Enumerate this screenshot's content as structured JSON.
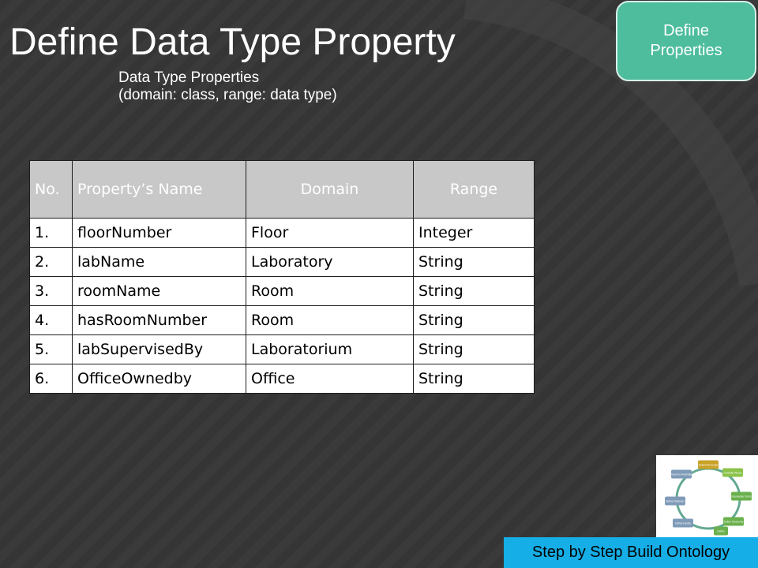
{
  "title": "Define Data Type Property",
  "subtitle": {
    "line1": "Data Type Properties",
    "line2": "(domain: class, range: data type)"
  },
  "badge": {
    "line1": "Define",
    "line2": "Properties"
  },
  "table": {
    "headers": [
      "No.",
      "Property’s Name",
      "Domain",
      "Range"
    ],
    "rows": [
      [
        "1.",
        "floorNumber",
        "Floor",
        "Integer"
      ],
      [
        "2.",
        "labName",
        "Laboratory",
        "String"
      ],
      [
        "3.",
        "roomName",
        "Room",
        "String"
      ],
      [
        "4.",
        "hasRoomNumber",
        "Room",
        "String"
      ],
      [
        "5.",
        "labSupervisedBy",
        "Laboratorium",
        "String"
      ],
      [
        "6.",
        "OfficeOwnedby",
        "Office",
        "String"
      ]
    ]
  },
  "cycle_diagram": {
    "steps": [
      "Determine Scope",
      "Consider Reuse",
      "Enumerate Terms",
      "Define Taxonomy",
      "Define",
      "Define Facets",
      "Define Instances",
      "Check for Anomalies"
    ]
  },
  "footer": "Step by Step Build Ontology",
  "colors": {
    "background": "#3a3a3a",
    "badge": "#4dbd9d",
    "header_cell": "#c8c8c8",
    "footer": "#16aee6"
  }
}
